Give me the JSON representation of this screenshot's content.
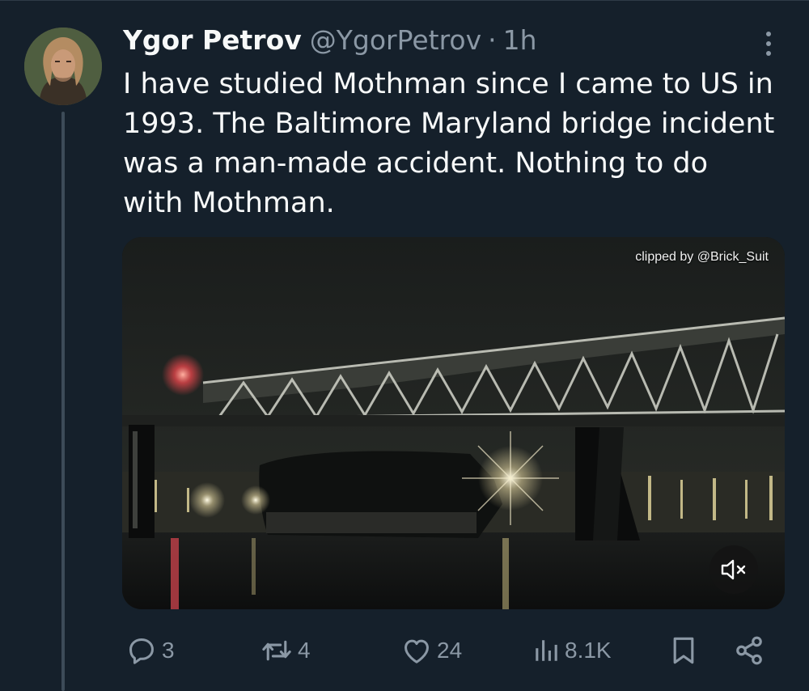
{
  "tweet": {
    "display_name": "Ygor Petrov",
    "handle": "@YgorPetrov",
    "separator": "·",
    "time": "1h",
    "text": "I have studied Mothman since I came to US in\n1993. The Baltimore Maryland bridge incident\nwas a man-made accident. Nothing to do\nwith Mothman."
  },
  "media": {
    "watermark": "clipped by @Brick_Suit",
    "mute_icon": "speaker-muted-icon"
  },
  "actions": {
    "replies": "3",
    "reposts": "4",
    "likes": "24",
    "views": "8.1K"
  },
  "icons": {
    "reply": "reply-icon",
    "repost": "repost-icon",
    "like": "heart-icon",
    "views": "views-chart-icon",
    "bookmark": "bookmark-icon",
    "share": "share-icon",
    "more": "more-options-icon"
  },
  "colors": {
    "background": "#15202b",
    "text": "#f7f9f9",
    "secondary_text": "#8b98a5",
    "thread_line": "#3d4b58"
  }
}
